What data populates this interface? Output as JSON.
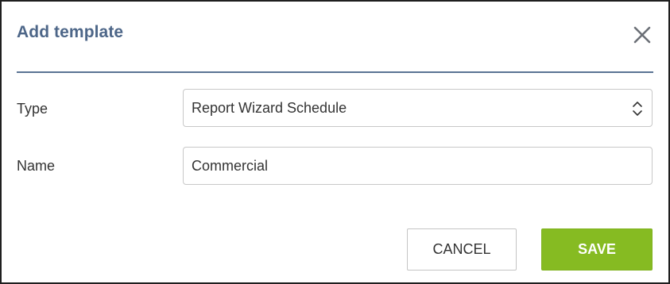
{
  "dialog": {
    "title": "Add template",
    "close_icon": "close-icon"
  },
  "form": {
    "type_label": "Type",
    "type_value": "Report Wizard Schedule",
    "type_icon": "select-arrows-icon",
    "name_label": "Name",
    "name_value": "Commercial"
  },
  "actions": {
    "cancel_label": "CANCEL",
    "save_label": "SAVE"
  },
  "colors": {
    "title": "#4d6688",
    "divider": "#5a7393",
    "save_button": "#86bb22"
  }
}
